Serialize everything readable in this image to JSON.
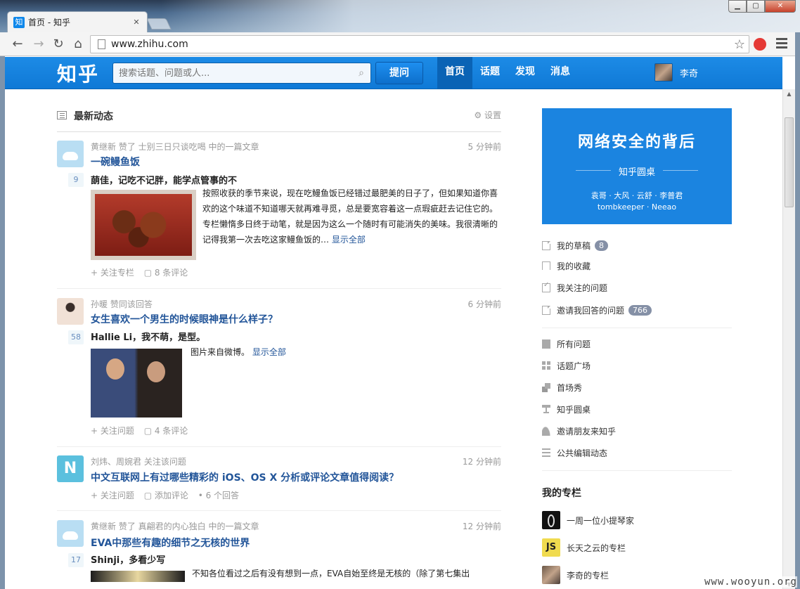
{
  "browser": {
    "tab_title": "首页 - 知乎",
    "tab_icon_text": "知",
    "url": "www.zhihu.com",
    "win_minimize": "▭",
    "win_maximize": "▢",
    "win_close": "✕"
  },
  "header": {
    "logo": "知乎",
    "search_placeholder": "搜索话题、问题或人...",
    "ask_button": "提问",
    "nav": [
      "首页",
      "话题",
      "发现",
      "消息"
    ],
    "user_name": "李奇"
  },
  "feed": {
    "title": "最新动态",
    "settings": "设置",
    "items": [
      {
        "meta": "黄继新 赞了 士别三日只谈吃喝 中的一篇文章",
        "time": "5 分钟前",
        "title": "一碗鳗鱼饭",
        "votes": "9",
        "author": "蓢佳，记吃不记胖，能学点管事的不",
        "excerpt": "按照收获的季节来说，现在吃鳗鱼饭已经错过最肥美的日子了，但如果知道你喜欢的这个味道不知道哪天就再难寻觅，总是要宽容着这一点瑕疵赶去记住它的。专栏懒惰多日终于动笔，就是因为这么一个随时有可能消失的美味。我很清晰的记得我第一次去吃这家鳗鱼饭的…",
        "more": "显示全部",
        "actions": [
          "+ 关注专栏",
          "▢ 8 条评论"
        ]
      },
      {
        "meta": "孙暖 赞同该回答",
        "time": "6 分钟前",
        "title": "女生喜欢一个男生的时候眼神是什么样子？",
        "votes": "58",
        "author": "Hallie Li，我不萌，是型。",
        "excerpt": "图片来自微博。",
        "more": "显示全部",
        "actions": [
          "+ 关注问题",
          "▢ 4 条评论"
        ]
      },
      {
        "meta": "刘炜、周婉君 关注该问题",
        "time": "12 分钟前",
        "title": "中文互联网上有过哪些精彩的 iOS、OS X 分析或评论文章值得阅读？",
        "avatar_letter": "N",
        "actions": [
          "+ 关注问题",
          "▢ 添加评论",
          "• 6 个回答"
        ]
      },
      {
        "meta": "黄继新 赞了 真翩君的内心独白 中的一篇文章",
        "time": "12 分钟前",
        "title": "EVA中那些有趣的细节之无核的世界",
        "votes": "17",
        "author": "Shinji，多看少写",
        "excerpt": "不知各位看过之后有没有想到一点，EVA自始至终是无核的（除了第七集出"
      }
    ]
  },
  "sidebar": {
    "banner": {
      "title": "网络安全的背后",
      "subtitle": "知乎圆桌",
      "names_line1": "袁哥 · 大风 · 云舒 · 李普君",
      "names_line2": "tombkeeper · Neeao"
    },
    "links_group1": [
      {
        "label": "我的草稿",
        "badge": "8"
      },
      {
        "label": "我的收藏",
        "badge": ""
      },
      {
        "label": "我关注的问题",
        "badge": ""
      },
      {
        "label": "邀请我回答的问题",
        "badge": "766"
      }
    ],
    "links_group2": [
      "所有问题",
      "话题广场",
      "首场秀",
      "知乎圆桌",
      "邀请朋友来知乎",
      "公共编辑动态"
    ],
    "columns_title": "我的专栏",
    "columns": [
      "一周一位小提琴家",
      "长天之云的专栏",
      "李奇的专栏"
    ],
    "js_badge": "JS"
  },
  "watermark": "www.wooyun.org"
}
